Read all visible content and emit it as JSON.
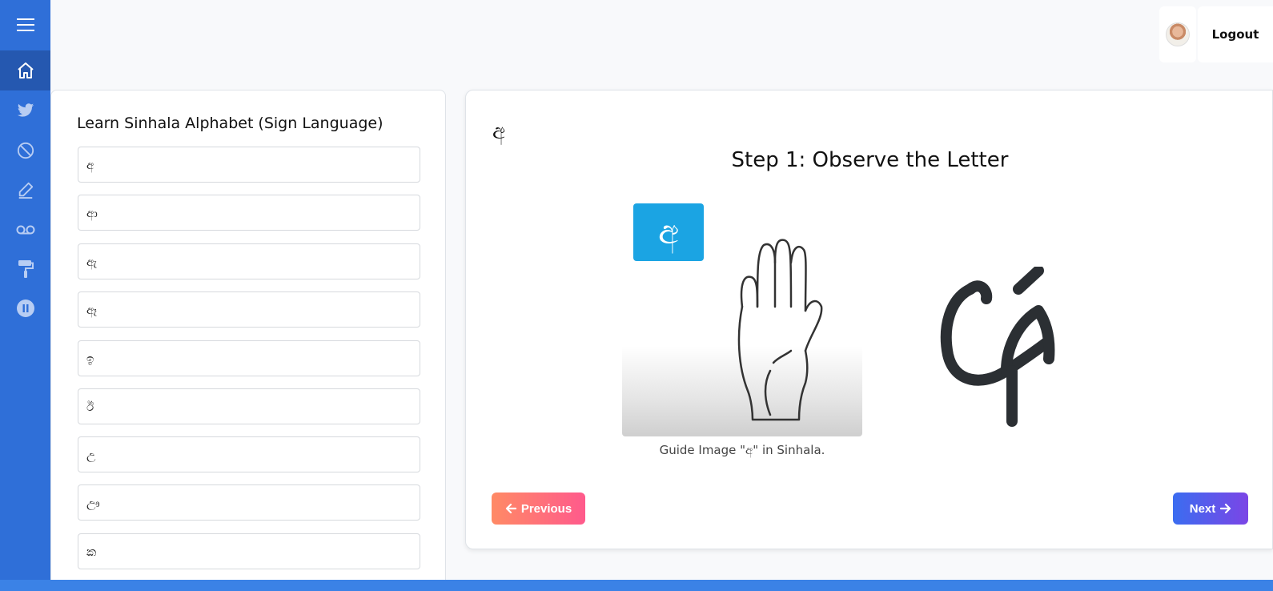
{
  "sidebar": {
    "items": [
      {
        "icon": "menu-icon"
      },
      {
        "icon": "home-icon",
        "active": true
      },
      {
        "icon": "twitter-icon"
      },
      {
        "icon": "block-icon"
      },
      {
        "icon": "pencil-icon"
      },
      {
        "icon": "voicemail-icon"
      },
      {
        "icon": "paint-roller-icon"
      },
      {
        "icon": "pause-circle-icon"
      }
    ]
  },
  "header": {
    "logout_label": "Logout"
  },
  "alphabet_panel": {
    "title": "Learn Sinhala Alphabet (Sign Language)",
    "letters": [
      "අ",
      "ආ",
      "ඇ",
      "ඈ",
      "ඉ",
      "ඊ",
      "උ",
      "ඌ",
      "ක"
    ]
  },
  "lesson": {
    "current_letter": "අ",
    "step_title": "Step 1: Observe the Letter",
    "badge_letter": "අ",
    "guide_caption": "Guide Image \"අ\" in Sinhala.",
    "previous_label": "Previous",
    "next_label": "Next"
  },
  "colors": {
    "sidebar": "#2f6fd8",
    "badge": "#1ba4e3",
    "previous_gradient": [
      "#ff8a65",
      "#ff5a8c"
    ],
    "next_gradient": [
      "#3b6df0",
      "#7b45e6"
    ]
  }
}
